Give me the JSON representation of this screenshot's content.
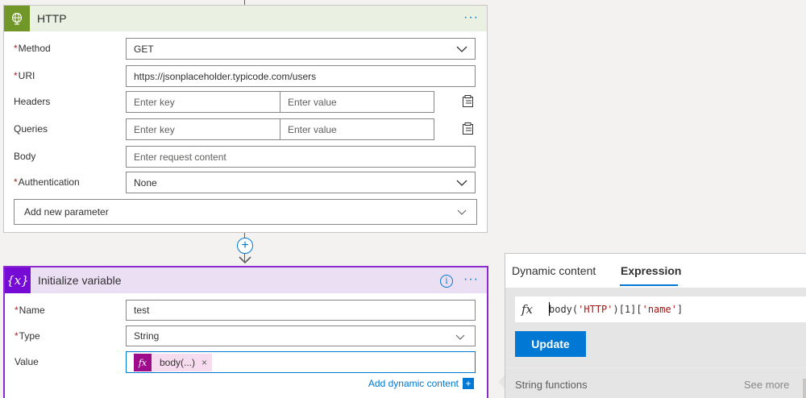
{
  "http": {
    "title": "HTTP",
    "more": "···",
    "method": {
      "label": "Method",
      "value": "GET"
    },
    "uri": {
      "label": "URI",
      "value": "https://jsonplaceholder.typicode.com/users"
    },
    "headers": {
      "label": "Headers",
      "key_placeholder": "Enter key",
      "value_placeholder": "Enter value"
    },
    "queries": {
      "label": "Queries",
      "key_placeholder": "Enter key",
      "value_placeholder": "Enter value"
    },
    "body": {
      "label": "Body",
      "placeholder": "Enter request content"
    },
    "authentication": {
      "label": "Authentication",
      "value": "None"
    },
    "add_param": "Add new parameter",
    "required_mark": "*"
  },
  "connector": {
    "plus": "+"
  },
  "variable": {
    "title": "Initialize variable",
    "icon": "{x}",
    "info": "i",
    "more": "···",
    "name": {
      "label": "Name",
      "value": "test"
    },
    "type": {
      "label": "Type",
      "value": "String"
    },
    "value": {
      "label": "Value",
      "token_icon": "fx",
      "token_text": "body(...)",
      "token_remove": "×"
    },
    "add_dynamic": "Add dynamic content",
    "add_dynamic_icon": "+"
  },
  "expression_panel": {
    "tabs": [
      "Dynamic content",
      "Expression"
    ],
    "active_tab": "Expression",
    "fx": "fx",
    "code_prefix": "body(",
    "code_str1": "'HTTP'",
    "code_mid": ")[1][",
    "code_str2": "'name'",
    "code_suffix": "]",
    "update_label": "Update",
    "section_label": "String functions",
    "see_more": "See more"
  },
  "colors": {
    "http_accent": "#709727",
    "variable_accent": "#770bd6",
    "link_blue": "#0078d4",
    "required_red": "#a4262c"
  }
}
